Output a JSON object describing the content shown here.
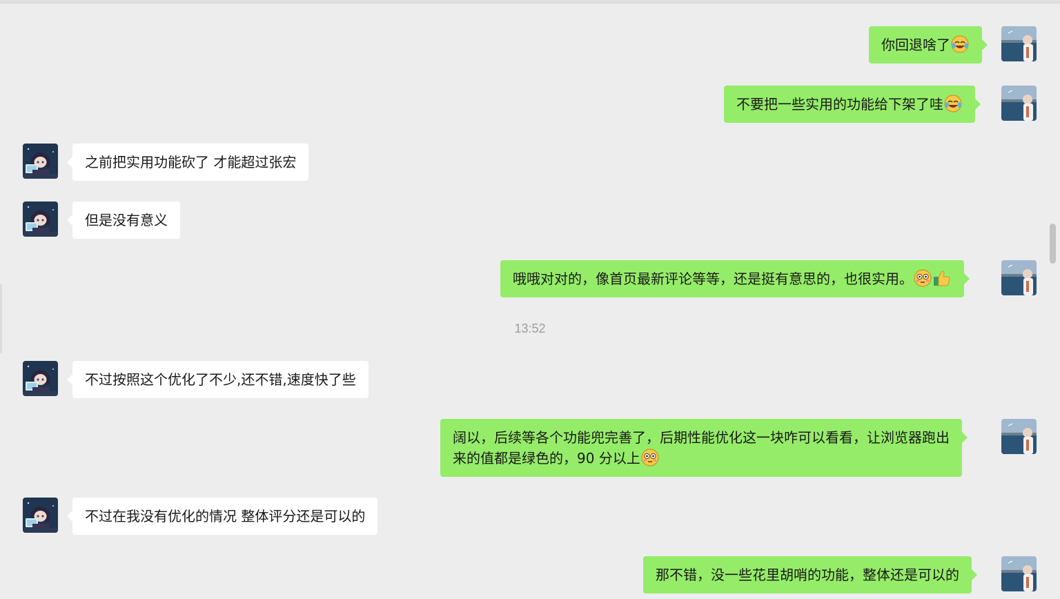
{
  "colors": {
    "background": "#ededed",
    "my_bubble": "#95ec69",
    "their_bubble": "#ffffff",
    "text": "#191919",
    "timestamp": "#9d9d9d"
  },
  "messages": [
    {
      "side": "me",
      "text": "你回退啥了",
      "emojis": [
        "laugh-cry"
      ]
    },
    {
      "side": "me",
      "text": "不要把一些实用的功能给下架了哇",
      "emojis": [
        "laugh-cry"
      ]
    },
    {
      "side": "them",
      "text": "之前把实用功能砍了 才能超过张宏",
      "emojis": []
    },
    {
      "side": "them",
      "text": "但是没有意义",
      "emojis": []
    },
    {
      "side": "me",
      "text": "哦哦对对的，像首页最新评论等等，还是挺有意思的，也很实用。",
      "emojis": [
        "flushed",
        "thumbs-up"
      ]
    },
    {
      "side": "them",
      "text": "不过按照这个优化了不少,还不错,速度快了些",
      "emojis": []
    },
    {
      "side": "me",
      "line1": "阔以，后续等各个功能兜完善了，后期性能优化这一块咋可以看看，让浏览器跑出",
      "line2": "来的值都是绿色的，90 分以上",
      "emojis": [
        "flushed"
      ]
    },
    {
      "side": "them",
      "text": "不过在我没有优化的情况 整体评分还是可以的",
      "emojis": []
    },
    {
      "side": "me",
      "text": "那不错，没一些花里胡哨的功能，整体还是可以的",
      "emojis": []
    }
  ],
  "timestamp": "13:52"
}
